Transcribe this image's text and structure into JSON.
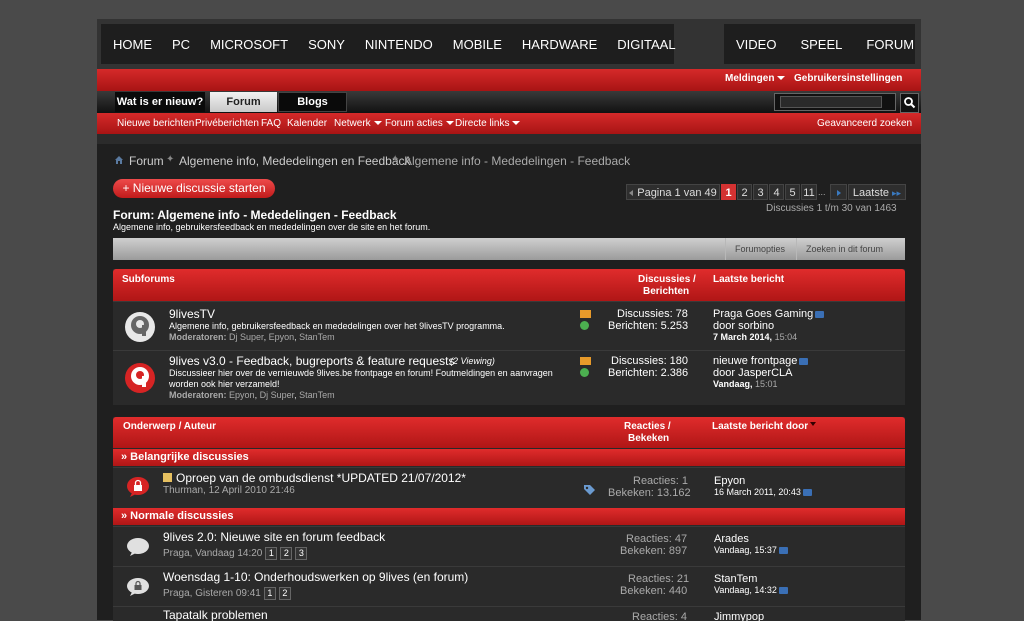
{
  "topnav": {
    "left": [
      "HOME",
      "PC",
      "MICROSOFT",
      "SONY",
      "NINTENDO",
      "MOBILE",
      "HARDWARE",
      "DIGITAAL"
    ],
    "right": [
      "VIDEO",
      "SPEEL",
      "FORUM"
    ]
  },
  "util": {
    "notifications": "Meldingen",
    "settings": "Gebruikersinstellingen"
  },
  "tabs": {
    "whatsnew": "Wat is er nieuw?",
    "forum": "Forum",
    "blogs": "Blogs"
  },
  "search": {
    "placeholder": ""
  },
  "subnav": {
    "items": [
      "Nieuwe berichten",
      "Privéberichten",
      "FAQ",
      "Kalender",
      "Netwerk",
      "Forum acties",
      "Directe links"
    ],
    "advanced": "Geavanceerd zoeken"
  },
  "breadcrumb": [
    "Forum",
    "Algemene info, Mededelingen en Feedback",
    "Algemene info - Mededelingen - Feedback"
  ],
  "new_thread": "+ Nieuwe discussie starten",
  "pager": {
    "label": "Pagina 1 van 49",
    "pages": [
      "1",
      "2",
      "3",
      "4",
      "5",
      "11"
    ],
    "ellipsis": "...",
    "last": "Laatste",
    "summary": "Discussies 1 t/m 30 van 1463"
  },
  "forum": {
    "title": "Forum: Algemene info - Mededelingen - Feedback",
    "desc": "Algemene info, gebruikersfeedback en mededelingen over de site en het forum."
  },
  "toolbar": {
    "options": "Forumopties",
    "search": "Zoeken in dit forum"
  },
  "subforums": {
    "head": {
      "title": "Subforums",
      "disc": "Discussies /",
      "posts": "Berichten",
      "last": "Laatste bericht"
    },
    "rows": [
      {
        "title": "9livesTV",
        "desc": "Algemene info, gebruikersfeedback en mededelingen over het 9livesTV programma.",
        "desc2": "",
        "mods_label": "Moderatoren:",
        "mods": [
          "Dj Super",
          "Epyon",
          "StanTem"
        ],
        "viewing": "",
        "disc": "Discussies: 78",
        "posts": "Berichten: 5.253",
        "last_title": "Praga Goes Gaming",
        "last_by": "door sorbino",
        "last_date": "7 March 2014,",
        "last_time": "15:04"
      },
      {
        "title": "9lives v3.0 - Feedback, bugreports & feature requests",
        "desc": "Discussieer hier over de vernieuwde 9lives.be frontpage en forum! Foutmeldingen en aanvragen",
        "desc2": "worden ook hier verzameld!",
        "mods_label": "Moderatoren:",
        "mods": [
          "Epyon",
          "Dj Super",
          "StanTem"
        ],
        "viewing": "(2 Viewing)",
        "disc": "Discussies: 180",
        "posts": "Berichten: 2.386",
        "last_title": "nieuwe frontpage",
        "last_by": "door JasperCLA",
        "last_date": "Vandaag,",
        "last_time": "15:01"
      }
    ]
  },
  "threads": {
    "head": {
      "title": "Onderwerp / Auteur",
      "replies": "Reacties /",
      "views": "Bekeken",
      "last": "Laatste bericht door"
    },
    "sticky_label": "» Belangrijke discussies",
    "normal_label": "» Normale discussies",
    "sticky": [
      {
        "title": "Oproep van de ombudsdienst *UPDATED 21/07/2012*",
        "meta": "Thurman, 12 April 2010 21:46",
        "pages": [],
        "replies": "Reacties: 1",
        "views": "Bekeken: 13.162",
        "last_user": "Epyon",
        "last_date": "16 March 2011, 20:43"
      }
    ],
    "normal": [
      {
        "title": "9lives 2.0: Nieuwe site en forum feedback",
        "meta": "Praga, Vandaag 14:20",
        "pages": [
          "1",
          "2",
          "3"
        ],
        "replies": "Reacties: 47",
        "views": "Bekeken: 897",
        "last_user": "Arades",
        "last_date": "Vandaag, 15:37"
      },
      {
        "title": "Woensdag 1-10: Onderhoudswerken op 9lives (en forum)",
        "meta": "Praga, Gisteren 09:41",
        "pages": [
          "1",
          "2"
        ],
        "replies": "Reacties: 21",
        "views": "Bekeken: 440",
        "last_user": "StanTem",
        "last_date": "Vandaag, 14:32"
      },
      {
        "title": "Tapatalk problemen",
        "meta": "",
        "pages": [],
        "replies": "Reacties: 4",
        "views": "",
        "last_user": "Jimmypop",
        "last_date": ""
      }
    ]
  },
  "colors": {
    "accent": "#d42a2a",
    "bg": "#1f1f1f"
  }
}
